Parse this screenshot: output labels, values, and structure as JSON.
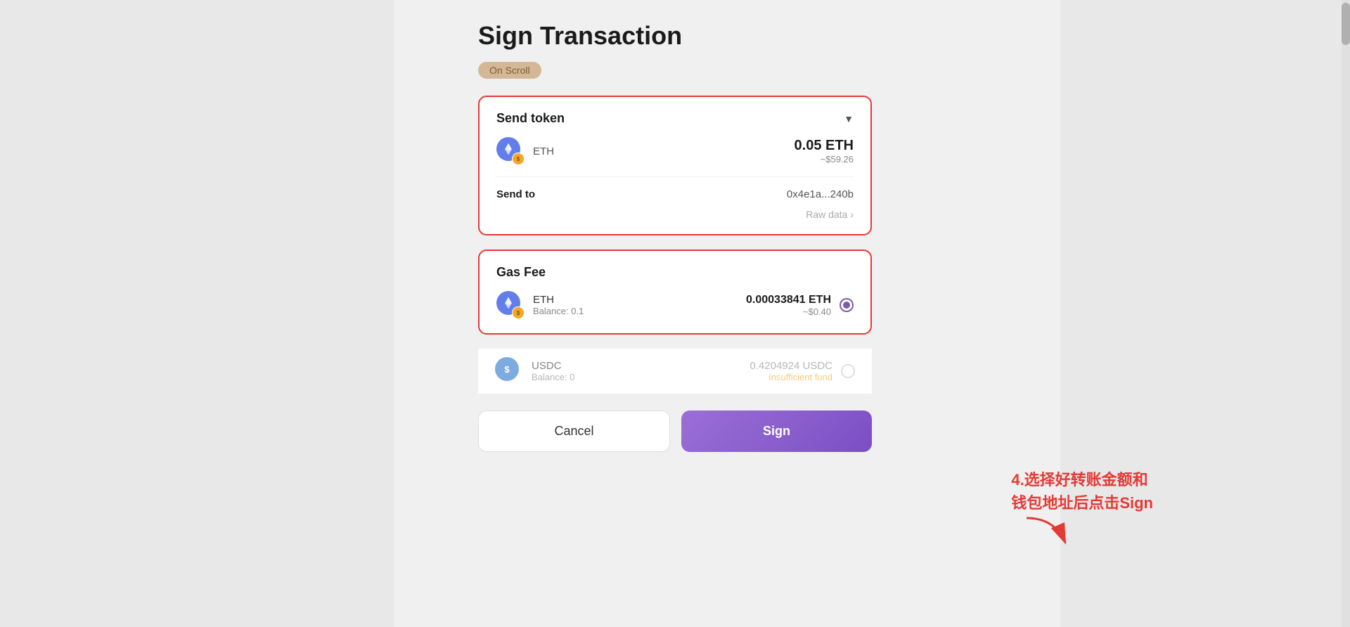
{
  "page": {
    "title": "Sign Transaction",
    "network": "On Scroll"
  },
  "send_token_card": {
    "header": "Send token",
    "token_name": "ETH",
    "amount": "0.05 ETH",
    "amount_usd": "~$59.26",
    "send_to_label": "Send to",
    "send_to_address": "0x4e1a...240b",
    "raw_data": "Raw data"
  },
  "gas_fee_card": {
    "header": "Gas Fee",
    "eth_name": "ETH",
    "eth_balance_label": "Balance: 0.1",
    "eth_amount": "0.00033841 ETH",
    "eth_amount_usd": "~$0.40"
  },
  "usdc_row": {
    "name": "USDC",
    "balance_label": "Balance: 0",
    "amount": "0.4204924 USDC",
    "status": "Insufficient fund"
  },
  "buttons": {
    "cancel": "Cancel",
    "sign": "Sign"
  },
  "annotation": {
    "text": "4.选择好转账金额和\n钱包地址后点击Sign"
  }
}
